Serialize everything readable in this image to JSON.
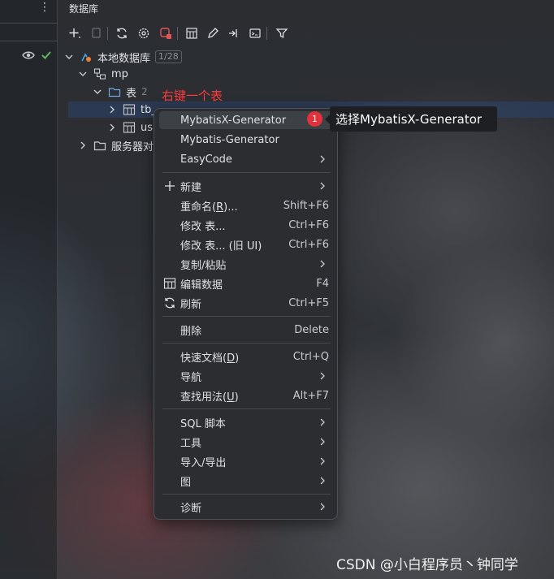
{
  "panel": {
    "title": "数据库"
  },
  "toolbar": {
    "icons": [
      "add-icon",
      "copy-icon",
      "refresh-icon",
      "gear-icon",
      "stop-icon",
      "table-icon",
      "edit-icon",
      "jump-icon",
      "console-icon",
      "filter-icon"
    ]
  },
  "tree": {
    "root": {
      "label": "本地数据库",
      "count": "1/28"
    },
    "schema": {
      "label": "mp"
    },
    "tables_folder": {
      "label": "表",
      "count": "2"
    },
    "table1": {
      "label": "tb_"
    },
    "table2": {
      "label": "us"
    },
    "server_objects": {
      "label": "服务器对"
    }
  },
  "annotations": {
    "right_click_hint": "右键一个表",
    "step_badge": "1",
    "tooltip": "选择MybatisX-Generator"
  },
  "menu": {
    "items": [
      {
        "label": "MybatisX-Generator"
      },
      {
        "label": "Mybatis-Generator"
      },
      {
        "label": "EasyCode"
      },
      {
        "label": "新建"
      },
      {
        "label": "重命名(",
        "mnemonic": "R",
        "tail": ")...",
        "shortcut": "Shift+F6"
      },
      {
        "label": "修改 表...",
        "shortcut": "Ctrl+F6"
      },
      {
        "label": "修改 表... (旧 UI)",
        "shortcut": "Ctrl+F6"
      },
      {
        "label": "复制/粘贴"
      },
      {
        "label": "编辑数据",
        "shortcut": "F4"
      },
      {
        "label": "刷新",
        "shortcut": "Ctrl+F5"
      },
      {
        "label": "删除",
        "shortcut": "Delete"
      },
      {
        "label": "快速文档(",
        "mnemonic": "D",
        "tail": ")",
        "shortcut": "Ctrl+Q"
      },
      {
        "label": "导航"
      },
      {
        "label": "查找用法(",
        "mnemonic": "U",
        "tail": ")",
        "shortcut": "Alt+F7"
      },
      {
        "label": "SQL 脚本"
      },
      {
        "label": "工具"
      },
      {
        "label": "导入/导出"
      },
      {
        "label": "图"
      },
      {
        "label": "诊断"
      }
    ]
  },
  "watermark": "CSDN @小白程序员丶钟同学",
  "colors": {
    "accent_red": "#ff3b3b",
    "badge_red": "#e0313c",
    "selection": "#2e436e"
  }
}
